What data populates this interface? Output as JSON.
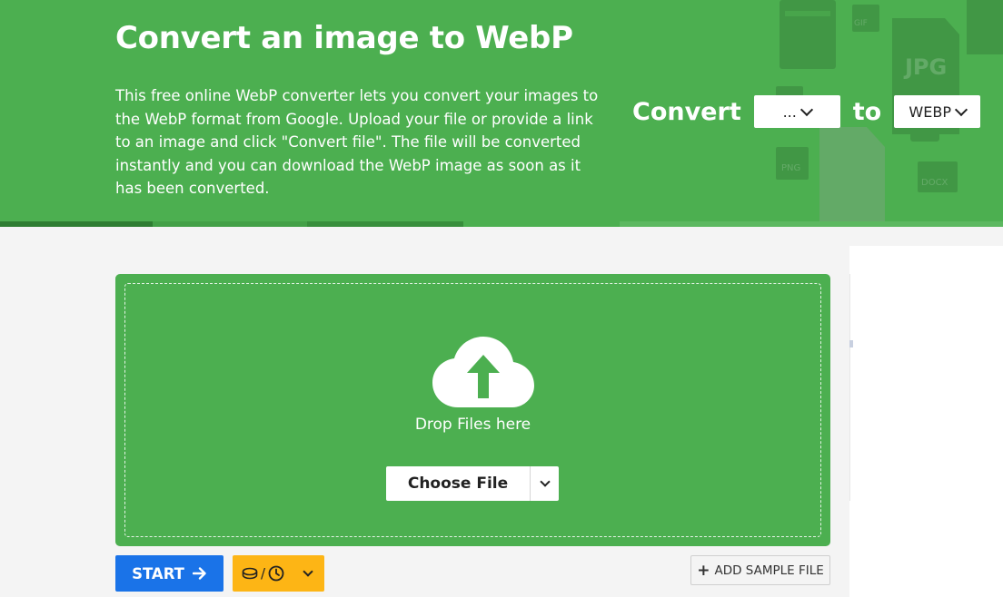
{
  "hero": {
    "title": "Convert an image to WebP",
    "description": "This free online WebP converter lets you convert your images to the WebP format from Google. Upload your file or provide a link to an image and click \"Convert file\". The file will be converted instantly and you can download the WebP image as soon as it has been converted.",
    "convert_label": "Convert",
    "to_label": "to",
    "from_format": "...",
    "to_format": "WEBP",
    "background_file_icons": [
      "email-icon",
      "gif-icon",
      "jpg-icon",
      "png-icon",
      "chart-file-icon",
      "printer-icon",
      "docx-icon"
    ]
  },
  "upload": {
    "drop_label": "Drop Files here",
    "choose_file_label": "Choose File"
  },
  "actions": {
    "start_label": "START",
    "options_separator": "/",
    "add_sample_label": "ADD SAMPLE FILE"
  },
  "colors": {
    "brand_green": "#4caf50",
    "start_blue": "#1a73e8",
    "options_yellow": "#fdb515"
  }
}
